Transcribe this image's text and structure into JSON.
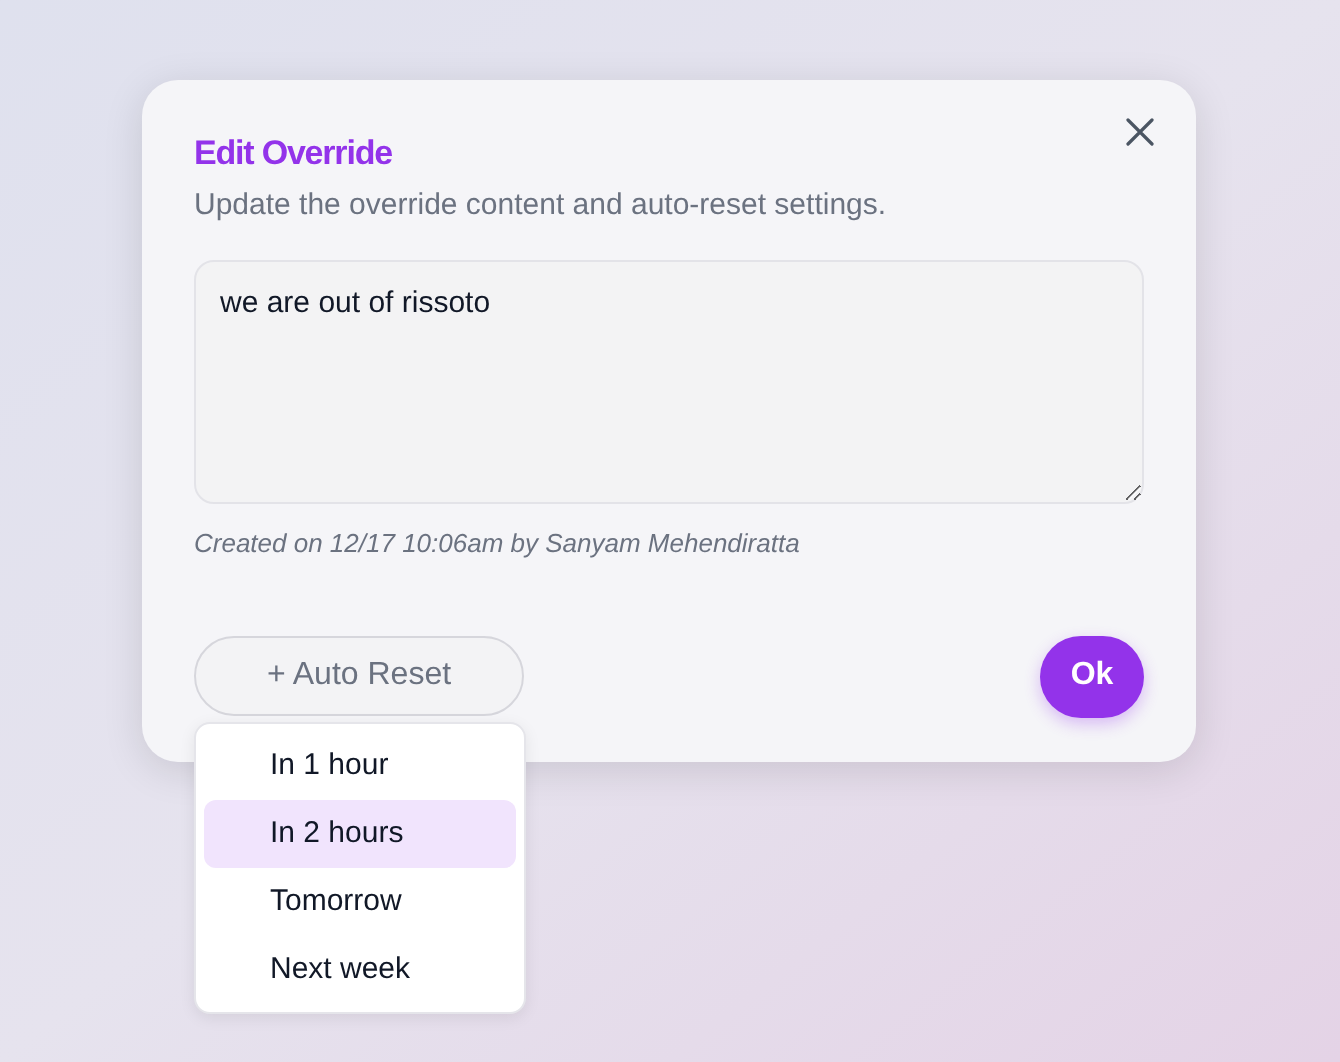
{
  "dialog": {
    "title": "Edit Override",
    "subtitle": "Update the override content and auto-reset settings.",
    "content": "we are out of rissoto",
    "created": "Created on 12/17 10:06am by Sanyam Mehendiratta",
    "auto_reset_button": "+ Auto Reset",
    "ok_button": "Ok"
  },
  "menu": [
    {
      "label": "In 1 hour",
      "selected": false
    },
    {
      "label": "In 2 hours",
      "selected": true
    },
    {
      "label": "Tomorrow",
      "selected": false
    },
    {
      "label": "Next week",
      "selected": false
    }
  ]
}
